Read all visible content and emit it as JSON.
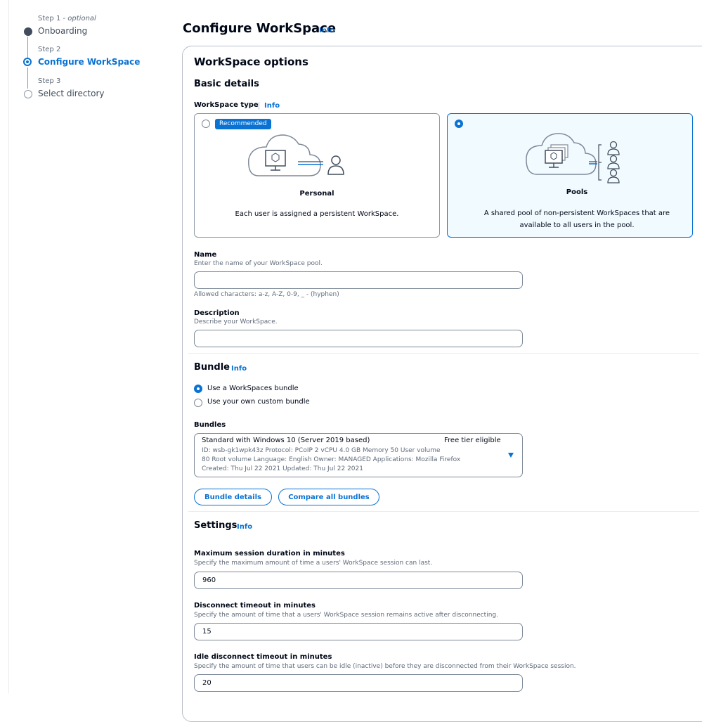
{
  "stepper": {
    "steps": [
      {
        "caption": "Step 1 - ",
        "optional": "optional",
        "label": "Onboarding"
      },
      {
        "caption": "Step 2",
        "label": "Configure WorkSpace"
      },
      {
        "caption": "Step 3",
        "label": "Select directory"
      }
    ]
  },
  "page": {
    "title": "Configure WorkSpace",
    "info": "Info"
  },
  "panel": {
    "title": "WorkSpace options"
  },
  "basic": {
    "title": "Basic details",
    "type_label": "WorkSpace type",
    "type_info": "Info",
    "personal": {
      "badge": "Recommended",
      "title": "Personal",
      "desc": "Each user is assigned a persistent WorkSpace."
    },
    "pools": {
      "title": "Pools",
      "desc": "A shared pool of non-persistent WorkSpaces that are available to all users in the pool."
    },
    "name": {
      "label": "Name",
      "desc": "Enter the name of your WorkSpace pool.",
      "value": "",
      "hint": "Allowed characters: a-z, A-Z, 0-9, _ - (hyphen)"
    },
    "description": {
      "label": "Description",
      "desc": "Describe your WorkSpace.",
      "value": ""
    }
  },
  "bundle": {
    "title": "Bundle",
    "info": "Info",
    "options": [
      "Use a WorkSpaces bundle",
      "Use your own custom bundle"
    ],
    "bundles_label": "Bundles",
    "selected": {
      "name": "Standard with Windows 10 (Server 2019 based)",
      "tag": "Free tier eligible",
      "line1": "ID: wsb-gk1wpk43z   Protocol: PCoIP   2 vCPU   4.0 GB Memory   50 User volume",
      "line2": "80 Root volume   Language: English   Owner: MANAGED   Applications: Mozilla Firefox",
      "line3": "Created: Thu Jul 22 2021   Updated: Thu Jul 22 2021"
    },
    "buttons": {
      "details": "Bundle details",
      "compare": "Compare all bundles"
    }
  },
  "settings": {
    "title": "Settings",
    "info": "Info",
    "max_session": {
      "label": "Maximum session duration in minutes",
      "desc": "Specify the maximum amount of time a users' WorkSpace session can last.",
      "value": "960"
    },
    "disconnect": {
      "label": "Disconnect timeout in minutes",
      "desc": "Specify the amount of time that a users' WorkSpace session remains active after disconnecting.",
      "value": "15"
    },
    "idle": {
      "label": "Idle disconnect timeout in minutes",
      "desc": "Specify the amount of time that users can be idle (inactive) before they are disconnected from their WorkSpace session.",
      "value": "20"
    }
  }
}
